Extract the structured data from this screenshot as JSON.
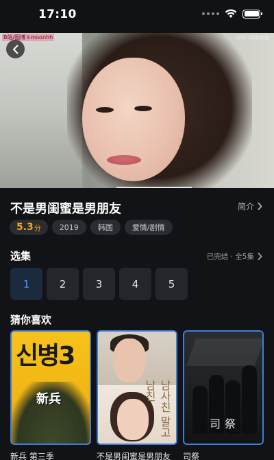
{
  "status_bar": {
    "time": "17:10"
  },
  "hero": {
    "watermark": "B站/图博 kmoonhh",
    "watermark_right": "译制: 韩韩/韩韩"
  },
  "show": {
    "title": "不是男闺蜜是男朋友",
    "intro_label": "简介",
    "score": "5.3",
    "score_unit": "分",
    "year": "2019",
    "region": "韩国",
    "genre": "爱情/剧情"
  },
  "episodes": {
    "section_title": "选集",
    "status": "已完结 · 全5集",
    "items": [
      "1",
      "2",
      "3",
      "4",
      "5"
    ],
    "selected_index": 0
  },
  "recommend": {
    "section_title": "猜你喜欢",
    "items": [
      {
        "title": "新兵 第三季",
        "poster_text": "신병3",
        "poster_label": "新兵"
      },
      {
        "title": "不是男闺蜜是男朋友",
        "poster_text": "남사친 말고 남친"
      },
      {
        "title": "司祭",
        "poster_text": "司祭"
      }
    ]
  },
  "colors": {
    "background": "#121316",
    "accent_blue": "#3d7fd6",
    "score_orange": "#f0a61a",
    "tag_bg": "#2b2c31"
  },
  "icons": {
    "back": "chevron-left-icon",
    "wifi": "wifi-icon",
    "battery": "battery-icon",
    "intro_arrow": "chevron-right-icon",
    "episodes_arrow": "chevron-right-icon"
  }
}
